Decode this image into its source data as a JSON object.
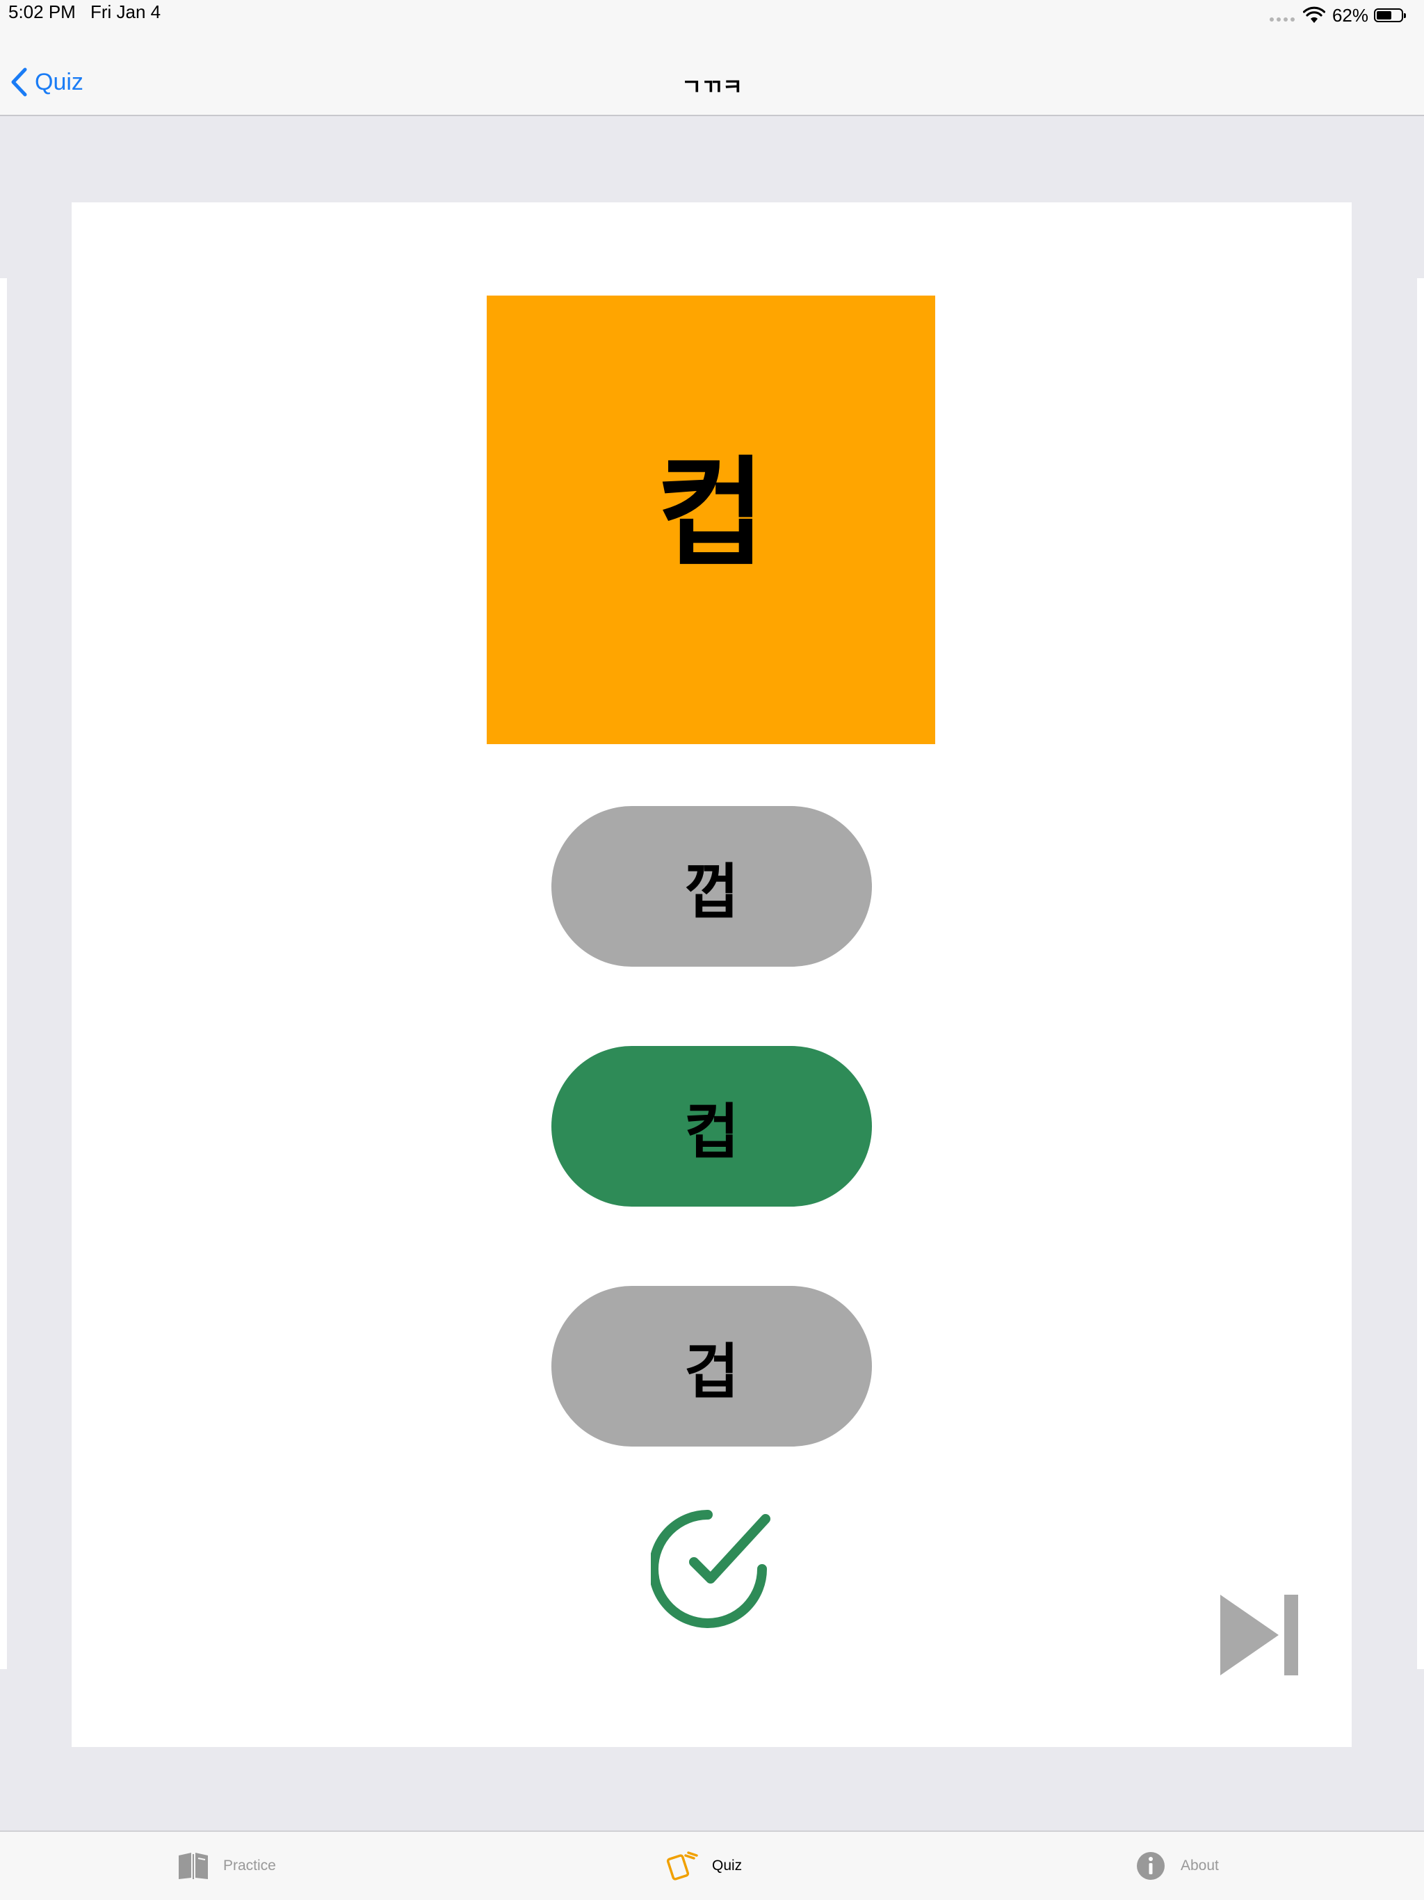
{
  "status_bar": {
    "time": "5:02 PM",
    "date": "Fri Jan 4",
    "battery_percent": "62%",
    "battery_level": 0.62
  },
  "nav": {
    "back_label": "Quiz",
    "title": "ㄱㄲㅋ"
  },
  "quiz": {
    "prompt": "컵",
    "options": [
      {
        "label": "껍",
        "state": "neutral"
      },
      {
        "label": "컵",
        "state": "correct"
      },
      {
        "label": "겁",
        "state": "neutral"
      }
    ],
    "result": "correct"
  },
  "tabs": [
    {
      "label": "Practice",
      "icon": "book-icon",
      "active": false
    },
    {
      "label": "Quiz",
      "icon": "cards-icon",
      "active": true
    },
    {
      "label": "About",
      "icon": "info-icon",
      "active": false
    }
  ],
  "colors": {
    "accent": "#1a7cf5",
    "prompt_tile": "#ffa500",
    "correct": "#2e8b57",
    "neutral_option": "#a9a9a9",
    "active_tab_icon": "#f0a000",
    "inactive": "#999999"
  }
}
